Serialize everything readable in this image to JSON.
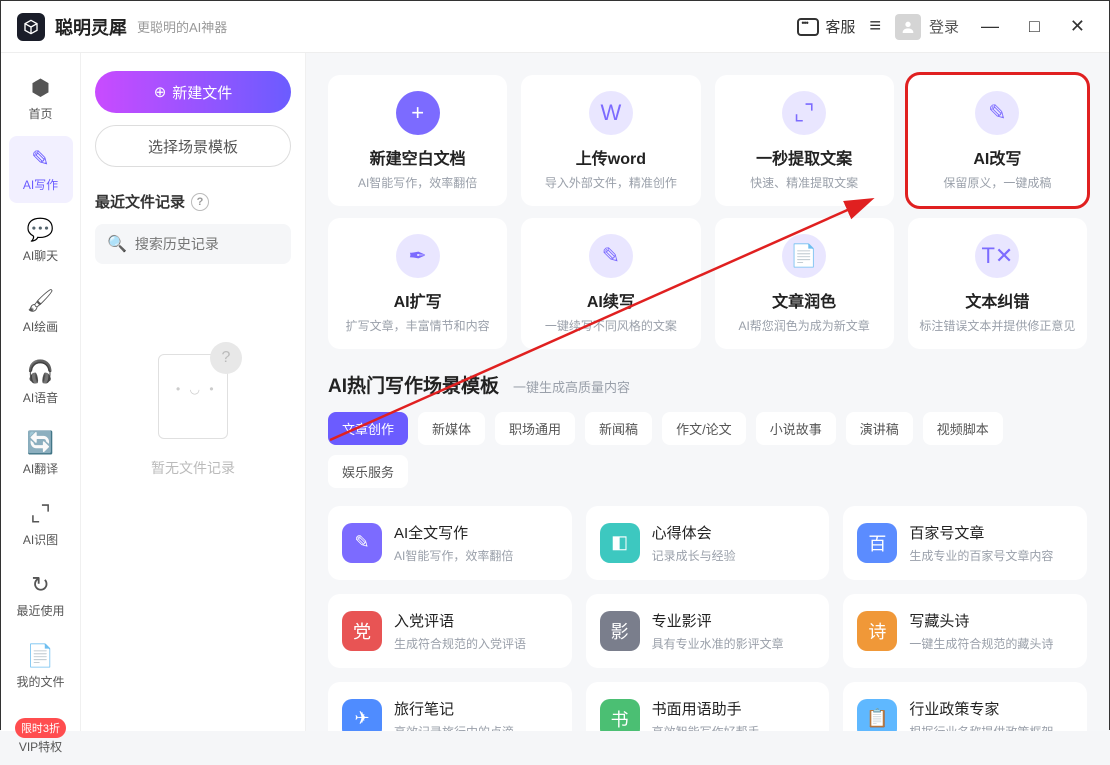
{
  "app": {
    "name": "聪明灵犀",
    "tagline": "更聪明的AI神器"
  },
  "titlebar": {
    "kefu": "客服",
    "login": "登录"
  },
  "nav": {
    "items": [
      {
        "label": "首页",
        "glyph": "⬢"
      },
      {
        "label": "AI写作",
        "glyph": "✎"
      },
      {
        "label": "AI聊天",
        "glyph": "💬"
      },
      {
        "label": "AI绘画",
        "glyph": "🖌"
      },
      {
        "label": "AI语音",
        "glyph": "🎧"
      },
      {
        "label": "AI翻译",
        "glyph": "🔄"
      },
      {
        "label": "AI识图",
        "glyph": "⌞⌝"
      }
    ],
    "footer": [
      {
        "label": "最近使用",
        "glyph": "↻"
      },
      {
        "label": "我的文件",
        "glyph": "📄"
      },
      {
        "label": "VIP特权",
        "glyph": "限时3折"
      }
    ],
    "active_index": 1
  },
  "sidebar": {
    "new_file": "新建文件",
    "choose_template": "选择场景模板",
    "recent_header": "最近文件记录",
    "search_placeholder": "搜索历史记录",
    "empty_text": "暂无文件记录"
  },
  "tools_row1": [
    {
      "title": "新建空白文档",
      "desc": "AI智能写作，效率翻倍",
      "glyph": "+"
    },
    {
      "title": "上传word",
      "desc": "导入外部文件，精准创作",
      "glyph": "W"
    },
    {
      "title": "一秒提取文案",
      "desc": "快速、精准提取文案",
      "glyph": "⌞⌝"
    },
    {
      "title": "AI改写",
      "desc": "保留原义，一键成稿",
      "glyph": "✎",
      "highlighted": true
    }
  ],
  "tools_row2": [
    {
      "title": "AI扩写",
      "desc": "扩写文章，丰富情节和内容",
      "glyph": "✒"
    },
    {
      "title": "AI续写",
      "desc": "一键续写不同风格的文案",
      "glyph": "✎"
    },
    {
      "title": "文章润色",
      "desc": "AI帮您润色为成为新文章",
      "glyph": "📄"
    },
    {
      "title": "文本纠错",
      "desc": "标注错误文本并提供修正意见",
      "glyph": "T✕"
    }
  ],
  "section": {
    "title": "AI热门写作场景模板",
    "subtitle": "一键生成高质量内容"
  },
  "tabs": [
    "文章创作",
    "新媒体",
    "职场通用",
    "新闻稿",
    "作文/论文",
    "小说故事",
    "演讲稿",
    "视频脚本",
    "娱乐服务"
  ],
  "active_tab": 0,
  "templates": [
    {
      "title": "AI全文写作",
      "desc": "AI智能写作，效率翻倍",
      "glyph": "✎",
      "bg": "bg-purple"
    },
    {
      "title": "心得体会",
      "desc": "记录成长与经验",
      "glyph": "◧",
      "bg": "bg-teal"
    },
    {
      "title": "百家号文章",
      "desc": "生成专业的百家号文章内容",
      "glyph": "百",
      "bg": "bg-blue"
    },
    {
      "title": "入党评语",
      "desc": "生成符合规范的入党评语",
      "glyph": "党",
      "bg": "bg-red"
    },
    {
      "title": "专业影评",
      "desc": "具有专业水准的影评文章",
      "glyph": "影",
      "bg": "bg-gray"
    },
    {
      "title": "写藏头诗",
      "desc": "一键生成符合规范的藏头诗",
      "glyph": "诗",
      "bg": "bg-orange"
    },
    {
      "title": "旅行笔记",
      "desc": "高效记录旅行中的点滴",
      "glyph": "✈",
      "bg": "bg-blue2"
    },
    {
      "title": "书面用语助手",
      "desc": "高效智能写作好帮手",
      "glyph": "书",
      "bg": "bg-green"
    },
    {
      "title": "行业政策专家",
      "desc": "根据行业名称提供政策框架",
      "glyph": "📋",
      "bg": "bg-sky"
    }
  ]
}
